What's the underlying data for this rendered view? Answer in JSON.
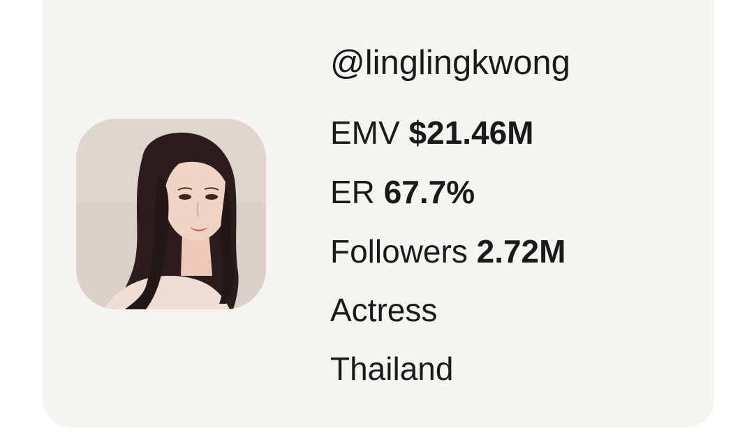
{
  "profile": {
    "handle": "@linglingkwong",
    "emv_label": "EMV",
    "emv_value": "$21.46M",
    "er_label": "ER",
    "er_value": "67.7%",
    "followers_label": "Followers",
    "followers_value": "2.72M",
    "occupation": "Actress",
    "location": "Thailand"
  },
  "colors": {
    "card_background": "#f5f4f1",
    "text": "#1a1a1a",
    "avatar_background": "#dccfc9"
  }
}
